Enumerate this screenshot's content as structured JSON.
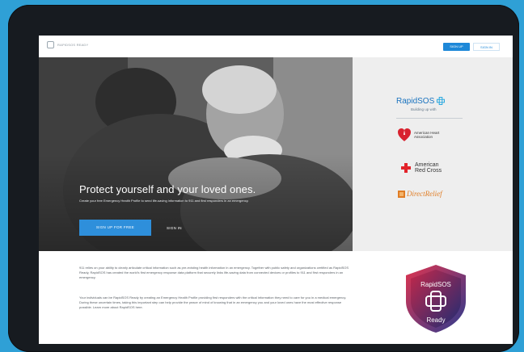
{
  "topbar": {
    "logo_text": "RAPIDSOS READY",
    "signup_label": "SIGN UP",
    "signin_label": "SIGN IN"
  },
  "hero": {
    "title": "Protect yourself and your loved ones.",
    "subtitle": "Create your free Emergency Health Profile to send life-saving information to 911 and first responders in an emergency.",
    "signup_button": "SIGN UP FOR FREE",
    "signin_link": "SIGN IN"
  },
  "partners": {
    "rapid_logo": "RapidSOS",
    "rapid_tagline": "Building up with",
    "aha": "American Heart Association",
    "redcross": "American Red Cross",
    "direct_relief": "DirectRelief"
  },
  "bottom": {
    "paragraph1": "911 relies on your ability to clearly articulate critical information such as pre-existing health information in an emergency. Together with public safety and organizations certified as RapidSOS Ready, RapidSOS has created the world's first emergency response data platform that securely links life-saving data from connected devices or profiles to 911 and first responders in an emergency.",
    "paragraph2": "Your individuals can be RapidSOS Ready by creating an Emergency Health Profile providing first responders with the critical information they need to care for you in a medical emergency. During these uncertain times, taking this important step can help provide the peace of mind of knowing that in an emergency you and your loved ones have the most effective response possible. Learn more about RapidSOS here.",
    "badge_top": "RapidSOS",
    "badge_bottom": "Ready"
  },
  "colors": {
    "background": "#2fa0d6",
    "brand_blue": "#1e88d8",
    "badge_red": "#e0344f",
    "badge_blue": "#2b3b8f"
  }
}
